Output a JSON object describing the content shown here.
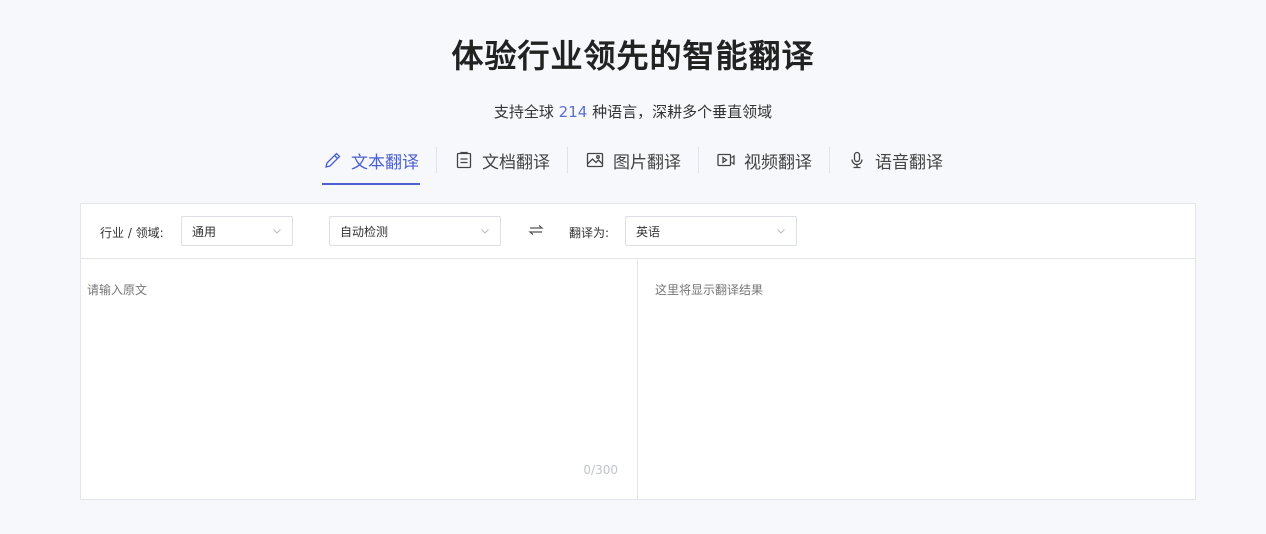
{
  "hero": {
    "title": "体验行业领先的智能翻译",
    "subtitle_prefix": "支持全球 ",
    "subtitle_count": "214",
    "subtitle_suffix": " 种语言，深耕多个垂直领域"
  },
  "tabs": [
    {
      "label": "文本翻译",
      "icon": "pencil-icon",
      "active": true
    },
    {
      "label": "文档翻译",
      "icon": "document-icon",
      "active": false
    },
    {
      "label": "图片翻译",
      "icon": "image-icon",
      "active": false
    },
    {
      "label": "视频翻译",
      "icon": "video-icon",
      "active": false
    },
    {
      "label": "语音翻译",
      "icon": "microphone-icon",
      "active": false
    }
  ],
  "toolbar": {
    "domain_label": "行业 / 领域:",
    "domain_value": "通用",
    "source_lang": "自动检测",
    "target_label": "翻译为:",
    "target_lang": "英语",
    "swap_icon": "swap-arrows-icon"
  },
  "editor": {
    "source_placeholder": "请输入原文",
    "char_count": "0/300",
    "result_placeholder": "这里将显示翻译结果"
  },
  "colors": {
    "accent": "#4d5fd1",
    "background": "#f6f8fc",
    "border": "#e3e5ea"
  }
}
